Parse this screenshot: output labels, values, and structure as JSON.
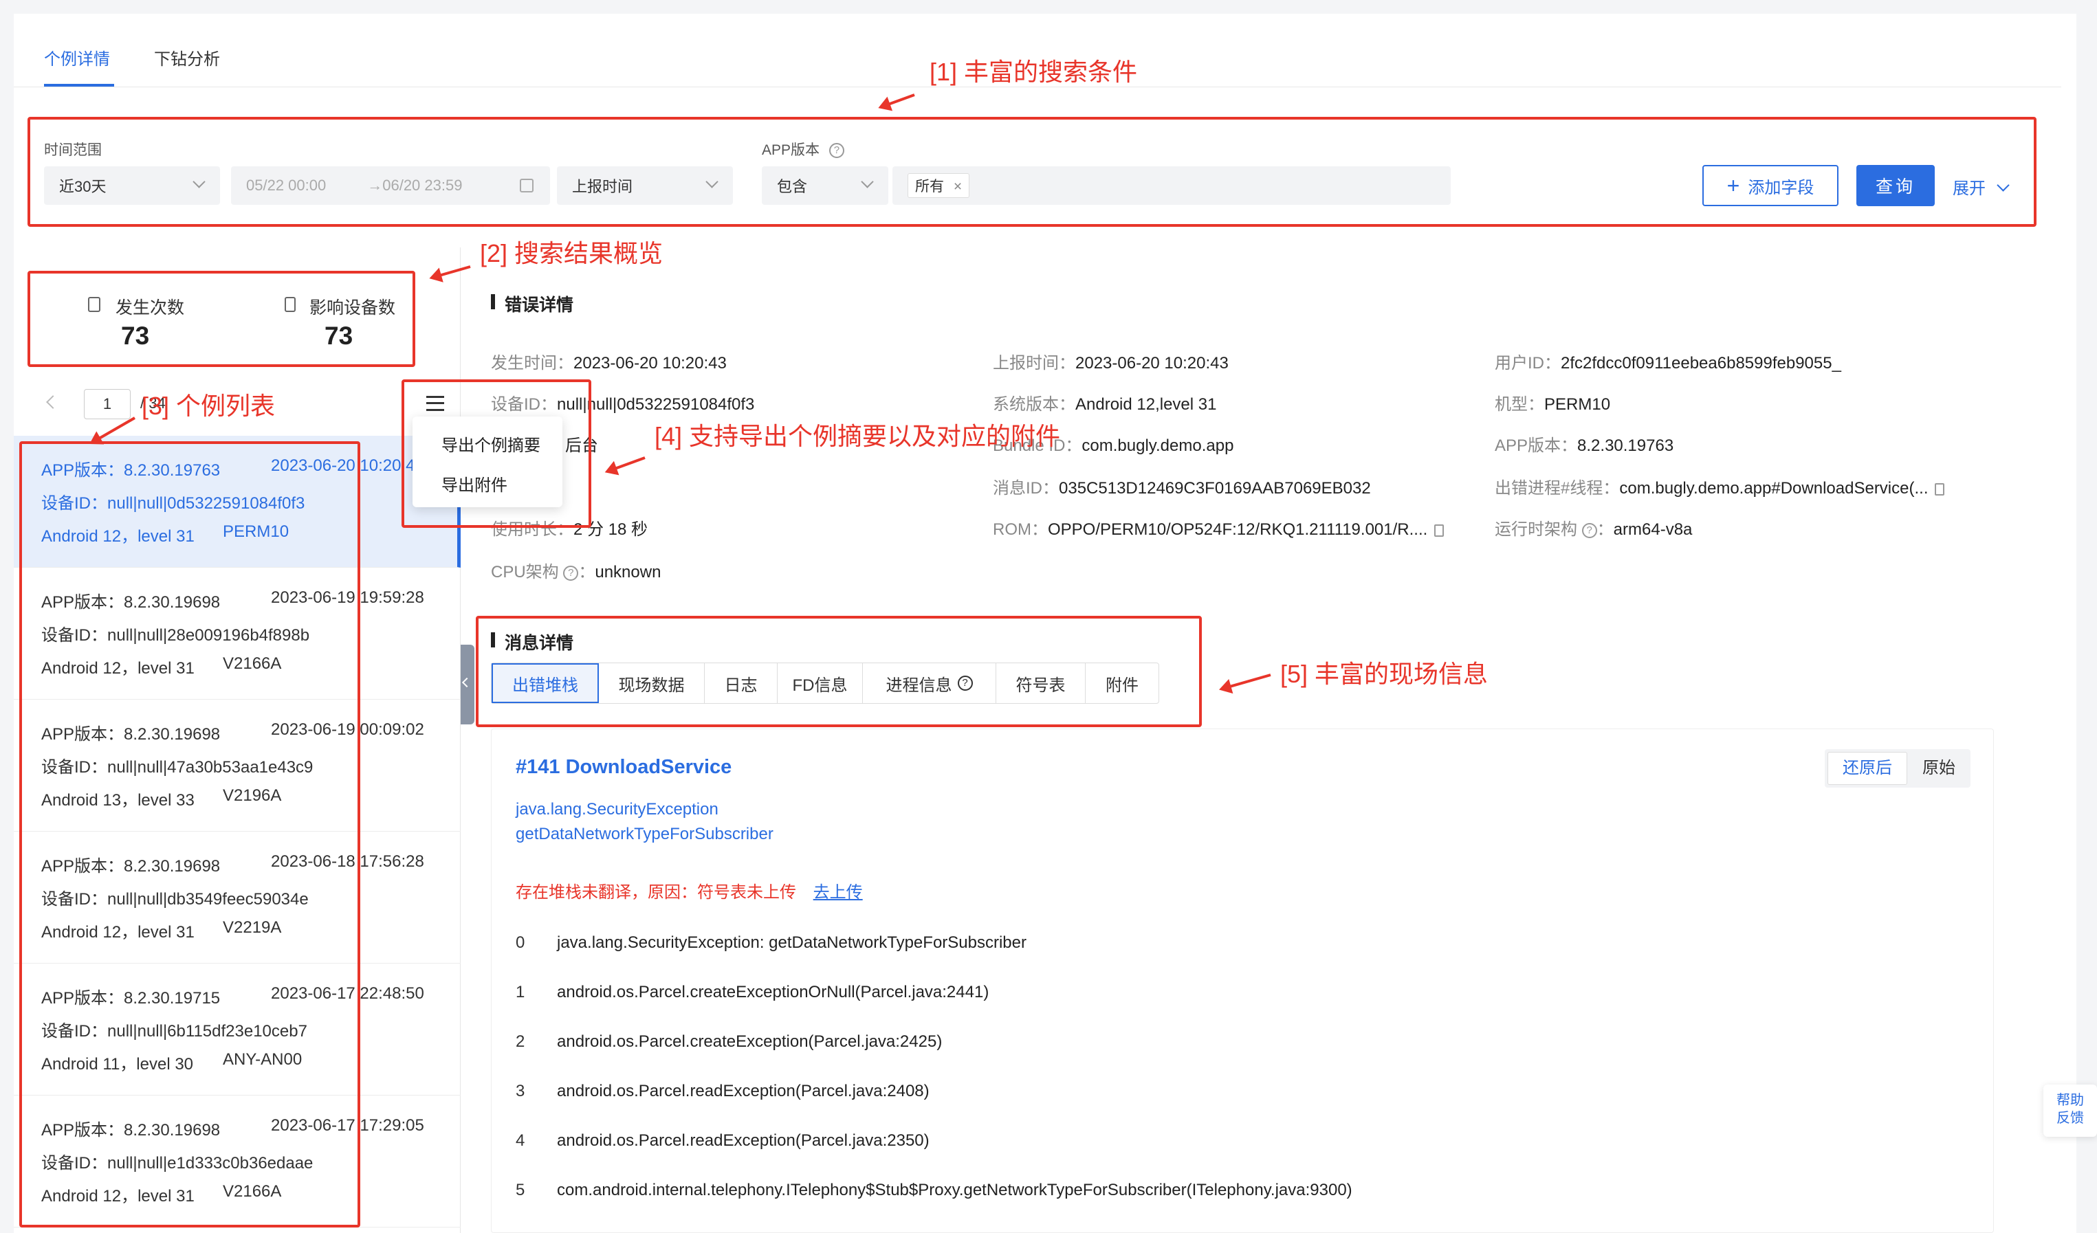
{
  "tabs": [
    {
      "label": "个例详情",
      "active": true
    },
    {
      "label": "下钻分析",
      "active": false
    }
  ],
  "search": {
    "time_range_label": "时间范围",
    "time_range_value": "近30天",
    "date_start": "05/22 00:00",
    "date_sep": "→",
    "date_end": "06/20 23:59",
    "time_type": "上报时间",
    "app_version_label": "APP版本",
    "op_value": "包含",
    "tag_value": "所有",
    "add_field": "添加字段",
    "query": "查询",
    "expand": "展开"
  },
  "stats": {
    "occurrence_label": "发生次数",
    "occurrence_value": "73",
    "devices_label": "影响设备数",
    "devices_value": "73"
  },
  "pager": {
    "current": "1",
    "total": "34"
  },
  "export_menu": [
    "导出个例摘要",
    "导出附件"
  ],
  "list_items": [
    {
      "version": "APP版本：8.2.30.19763",
      "date": "2023-06-20 10:20:43",
      "device": "设备ID：null|null|0d5322591084f0f3",
      "os": "Android 12，level 31",
      "model": "PERM10",
      "active": true
    },
    {
      "version": "APP版本：8.2.30.19698",
      "date": "2023-06-19 19:59:28",
      "device": "设备ID：null|null|28e009196b4f898b",
      "os": "Android 12，level 31",
      "model": "V2166A",
      "active": false
    },
    {
      "version": "APP版本：8.2.30.19698",
      "date": "2023-06-19 00:09:02",
      "device": "设备ID：null|null|47a30b53aa1e43c9",
      "os": "Android 13，level 33",
      "model": "V2196A",
      "active": false
    },
    {
      "version": "APP版本：8.2.30.19698",
      "date": "2023-06-18 17:56:28",
      "device": "设备ID：null|null|db3549feec59034e",
      "os": "Android 12，level 31",
      "model": "V2219A",
      "active": false
    },
    {
      "version": "APP版本：8.2.30.19715",
      "date": "2023-06-17 22:48:50",
      "device": "设备ID：null|null|6b115df23e10ceb7",
      "os": "Android 11，level 30",
      "model": "ANY-AN00",
      "active": false
    },
    {
      "version": "APP版本：8.2.30.19698",
      "date": "2023-06-17 17:29:05",
      "device": "设备ID：null|null|e1d333c0b36edaae",
      "os": "Android 12，level 31",
      "model": "V2166A",
      "active": false
    }
  ],
  "error_detail": {
    "title": "错误详情",
    "fields": [
      {
        "k": "发生时间：",
        "v": "2023-06-20 10:20:43"
      },
      {
        "k": "上报时间：",
        "v": "2023-06-20 10:20:43"
      },
      {
        "k": "用户ID：",
        "v": "2fc2fdcc0f0911eebea6b8599feb9055_"
      },
      {
        "k": "设备ID：",
        "v": "null|null|0d5322591084f0f3"
      },
      {
        "k": "系统版本：",
        "v": "Android 12,level 31"
      },
      {
        "k": "机型：",
        "v": "PERM10"
      },
      {
        "k": "",
        "v": "后台"
      },
      {
        "k": "Bundle ID：",
        "v": "com.bugly.demo.app"
      },
      {
        "k": "APP版本：",
        "v": "8.2.30.19763"
      },
      {
        "k": "消息ID：",
        "v": "035C513D12469C3F0169AAB7069EB032"
      },
      {
        "k": "出错进程#线程：",
        "v": "com.bugly.demo.app#DownloadService(..."
      },
      {
        "k": "使用时长：",
        "v": "2 分 18 秒"
      },
      {
        "k": "ROM：",
        "v": "OPPO/PERM10/OP524F:12/RKQ1.211119.001/R...."
      },
      {
        "k": "运行时架构",
        "v": "arm64-v8a"
      },
      {
        "k": "CPU架构",
        "v": "unknown"
      }
    ]
  },
  "message_detail": {
    "title": "消息详情",
    "subtabs": [
      "出错堆栈",
      "现场数据",
      "日志",
      "FD信息",
      "进程信息",
      "符号表",
      "附件"
    ]
  },
  "stack": {
    "thread_title": "#141 DownloadService",
    "exception": "java.lang.SecurityException",
    "method": "getDataNetworkTypeForSubscriber",
    "warning": "存在堆栈未翻译，原因：符号表未上传",
    "upload_link": "去上传",
    "restore_btn": "还原后",
    "raw_btn": "原始",
    "lines": [
      {
        "n": "0",
        "t": "java.lang.SecurityException: getDataNetworkTypeForSubscriber"
      },
      {
        "n": "1",
        "t": "android.os.Parcel.createExceptionOrNull(Parcel.java:2441)"
      },
      {
        "n": "2",
        "t": "android.os.Parcel.createException(Parcel.java:2425)"
      },
      {
        "n": "3",
        "t": "android.os.Parcel.readException(Parcel.java:2408)"
      },
      {
        "n": "4",
        "t": "android.os.Parcel.readException(Parcel.java:2350)"
      },
      {
        "n": "5",
        "t": "com.android.internal.telephony.ITelephony$Stub$Proxy.getNetworkTypeForSubscriber(ITelephony.java:9300)"
      }
    ]
  },
  "annotations": {
    "a1": "[1] 丰富的搜索条件",
    "a2": "[2] 搜索结果概览",
    "a3": "[3] 个例列表",
    "a4": "[4] 支持导出个例摘要以及对应的附件",
    "a5": "[5] 丰富的现场信息"
  },
  "help": {
    "line1": "帮助",
    "line2": "反馈"
  },
  "colors": {
    "primary": "#2b6de0",
    "annotation": "#e8352a"
  }
}
